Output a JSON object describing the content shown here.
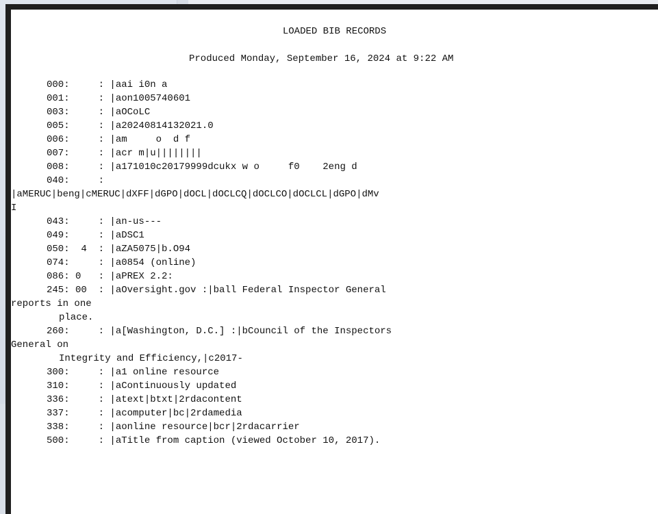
{
  "report": {
    "title": "LOADED BIB RECORDS",
    "produced": "Produced Monday, September 16, 2024 at 9:22 AM"
  },
  "records": [
    {
      "text": "000:     : |aai i0n a",
      "style": "normal"
    },
    {
      "text": "001:     : |aon1005740601",
      "style": "normal"
    },
    {
      "text": "003:     : |aOCoLC",
      "style": "normal"
    },
    {
      "text": "005:     : |a20240814132021.0",
      "style": "normal"
    },
    {
      "text": "006:     : |am     o  d f",
      "style": "normal"
    },
    {
      "text": "007:     : |acr m|u||||||||",
      "style": "normal"
    },
    {
      "text": "008:     : |a171010c20179999dcukx w o     f0    2eng d",
      "style": "normal"
    },
    {
      "text": "040:     :",
      "style": "normal"
    },
    {
      "text": "|aMERUC|beng|cMERUC|dXFF|dGPO|dOCL|dOCLCQ|dOCLCO|dOCLCL|dGPO|dMv",
      "style": "cont"
    },
    {
      "text": "I",
      "style": "cont"
    },
    {
      "text": "043:     : |an-us---",
      "style": "normal"
    },
    {
      "text": "049:     : |aDSC1",
      "style": "normal"
    },
    {
      "text": "050:  4  : |aZA5075|b.O94",
      "style": "normal"
    },
    {
      "text": "074:     : |a0854 (online)",
      "style": "normal"
    },
    {
      "text": "086: 0   : |aPREX 2.2:",
      "style": "normal"
    },
    {
      "text": "245: 00  : |aOversight.gov :|ball Federal Inspector General",
      "style": "normal"
    },
    {
      "text": "reports in one",
      "style": "cont"
    },
    {
      "text": "place.",
      "style": "indent"
    },
    {
      "text": "260:     : |a[Washington, D.C.] :|bCouncil of the Inspectors",
      "style": "normal"
    },
    {
      "text": "General on",
      "style": "cont"
    },
    {
      "text": "Integrity and Efficiency,|c2017-",
      "style": "indent"
    },
    {
      "text": "300:     : |a1 online resource",
      "style": "normal"
    },
    {
      "text": "310:     : |aContinuously updated",
      "style": "normal"
    },
    {
      "text": "336:     : |atext|btxt|2rdacontent",
      "style": "normal"
    },
    {
      "text": "337:     : |acomputer|bc|2rdamedia",
      "style": "normal"
    },
    {
      "text": "338:     : |aonline resource|bcr|2rdacarrier",
      "style": "normal"
    },
    {
      "text": "500:     : |aTitle from caption (viewed October 10, 2017).",
      "style": "normal"
    }
  ]
}
